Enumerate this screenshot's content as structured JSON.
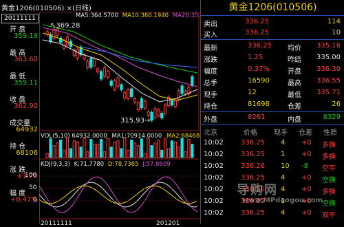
{
  "header": {
    "title": "黄金1206(010506)  ×(日线)",
    "ma_labels": [
      {
        "text": "MA5:364.5700",
        "color": "#e8e8e8"
      },
      {
        "text": "MA10:360.1940",
        "color": "#f0d200"
      },
      {
        "text": "MA20:352.7455",
        "color": "#d050d0"
      },
      {
        "text": "MA30:...",
        "color": "#18c818"
      }
    ]
  },
  "info": {
    "date": "20111111",
    "rows": [
      {
        "label": "开  盘",
        "value": "359.19",
        "color": "#18c818"
      },
      {
        "label": "最  高",
        "value": "363.60",
        "color": "#ff3c3c"
      },
      {
        "label": "最  低",
        "value": "359.11",
        "color": "#18c818"
      },
      {
        "label": "收  盘",
        "value": "362.90",
        "color": "#ff3c3c"
      },
      {
        "label": "成交量",
        "value": "64932",
        "color": "#f0d200"
      },
      {
        "label": "持  仓",
        "value": "68106",
        "color": "#f0d200"
      },
      {
        "label": "涨  跌",
        "value": "+1.70",
        "color": "#ff3c3c"
      },
      {
        "label": "幅  度",
        "value": "+0.47%",
        "color": "#ff3c3c"
      }
    ]
  },
  "chart": {
    "high_label": "369.28",
    "low_label": "315.93",
    "vol_header": [
      {
        "text": "VOL(5,10) 64932.0000",
        "color": "#e8e8e8"
      },
      {
        "text": "MA1:70914.0000",
        "color": "#e8e8e8"
      },
      {
        "text": "MA2:68468.",
        "color": "#f0d200"
      }
    ],
    "kdj_header": [
      {
        "text": "KDJ(9,3,3)",
        "color": "#e8e8e8"
      },
      {
        "text": "K:71.7780",
        "color": "#e8e8e8"
      },
      {
        "text": "D:78.7365",
        "color": "#f0d200"
      },
      {
        "text": "J:57.8609",
        "color": "#d050d0"
      }
    ],
    "kdj_ticks": [
      "100",
      "50",
      "0"
    ],
    "x_labels": [
      "20111111",
      "201201"
    ]
  },
  "quote": {
    "title": "黄金1206(010506)",
    "sell": {
      "label": "卖出",
      "price": "336.25",
      "qty": "114"
    },
    "buy": {
      "label": "买入",
      "price": "336.25",
      "qty": "10"
    },
    "stats": [
      {
        "l1": "最新",
        "v1": "336.25",
        "c1": "#ff3c3c",
        "l2": "均价",
        "v2": "335.16",
        "c2": "#ff3c3c"
      },
      {
        "l1": "涨跌",
        "v1": "1.25",
        "c1": "#ff3c3c",
        "l2": "昨结",
        "v2": "335.00",
        "c2": "#e8e8e8"
      },
      {
        "l1": "幅度",
        "v1": "0.37%",
        "c1": "#ff3c3c",
        "l2": "开盘",
        "v2": "336.30",
        "c2": "#ff3c3c"
      },
      {
        "l1": "总手",
        "v1": "16590",
        "c1": "#f0d200",
        "l2": "最高",
        "v2": "336.55",
        "c2": "#ff3c3c"
      },
      {
        "l1": "现手",
        "v1": "12",
        "c1": "#f0d200",
        "l2": "最低",
        "v2": "335.71",
        "c2": "#ff3c3c"
      },
      {
        "l1": "持仓",
        "v1": "81698",
        "c1": "#f0d200",
        "l2": "仓差",
        "v2": "26",
        "c2": "#f0d200"
      }
    ],
    "outer": {
      "label": "外盘",
      "value": "8261"
    },
    "inner": {
      "label": "内盘",
      "value": "8329"
    },
    "ticks_header": [
      "北京",
      "价格",
      "现手",
      "仓差",
      "性质"
    ],
    "ticks": [
      {
        "time": "10:02",
        "price": "336.25",
        "qty": "4",
        "diff": "+0",
        "type": "多换",
        "tcolor": "#ff3c3c"
      },
      {
        "time": "10:02",
        "price": "336.25",
        "qty": "1",
        "diff": "+0",
        "type": "多换",
        "tcolor": "#ff3c3c"
      },
      {
        "time": "10:02",
        "price": "336.26",
        "qty": "10",
        "diff": "-8",
        "type": "空平",
        "tcolor": "#ff3c3c"
      },
      {
        "time": "10:02",
        "price": "336.25",
        "qty": "4",
        "diff": "+0",
        "type": "空换",
        "tcolor": "#18c818"
      },
      {
        "time": "10:02",
        "price": "336.26",
        "qty": "4",
        "diff": "+0",
        "type": "多换",
        "tcolor": "#ff3c3c"
      },
      {
        "time": "10:02",
        "price": "336.25",
        "qty": "1",
        "diff": "+0",
        "type": "空换",
        "tcolor": "#18c818"
      },
      {
        "time": "10:02",
        "price": "336.25",
        "qty": "4",
        "diff": "+0",
        "type": "双平",
        "tcolor": "#ff3c3c"
      }
    ],
    "watermark": "www.MPdaogou.com",
    "watermark_logo": "导购网"
  }
}
